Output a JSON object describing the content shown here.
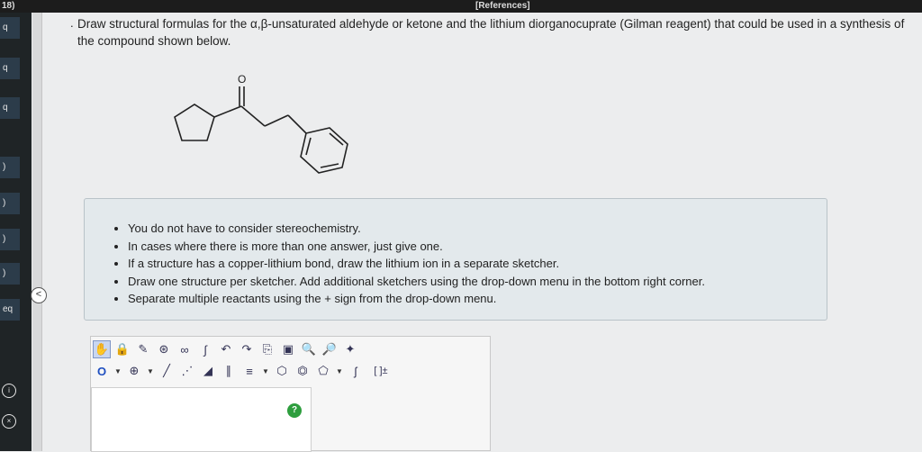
{
  "topbar": {
    "question_number": "18)",
    "references_label": "[References]"
  },
  "sidebar": {
    "items": [
      {
        "label": "q"
      },
      {
        "label": "q"
      },
      {
        "label": "q"
      },
      {
        "label": ")"
      },
      {
        "label": ")"
      },
      {
        "label": ")"
      },
      {
        "label": ")"
      },
      {
        "label": "eq"
      }
    ],
    "circles": [
      {
        "icon": "info-icon"
      },
      {
        "icon": "close-icon"
      }
    ],
    "collapse_label": "<"
  },
  "question": {
    "bullet": ".",
    "text": "Draw structural formulas for the α,β-unsaturated aldehyde or ketone and the lithium diorganocuprate (Gilman reagent) that could be used in a synthesis of the compound shown below."
  },
  "molecule": {
    "atom_label": "O"
  },
  "instructions": [
    "You do not have to consider stereochemistry.",
    "In cases where there is more than one answer, just give one.",
    "If a structure has a copper-lithium bond, draw the lithium ion in a separate sketcher.",
    "Draw one structure per sketcher. Add additional sketchers using the drop-down menu in the bottom right corner.",
    "Separate multiple reactants using the + sign from the drop-down menu."
  ],
  "sketcher": {
    "element_label": "O",
    "charge_label": "⊕",
    "bracket_label": "[ ]±",
    "help_label": "?"
  },
  "colors": {
    "topbar": "#1c1c1c",
    "sidebar": "#1f2426",
    "info_box": "#e3e9ec",
    "help_button": "#2e9e3e"
  }
}
